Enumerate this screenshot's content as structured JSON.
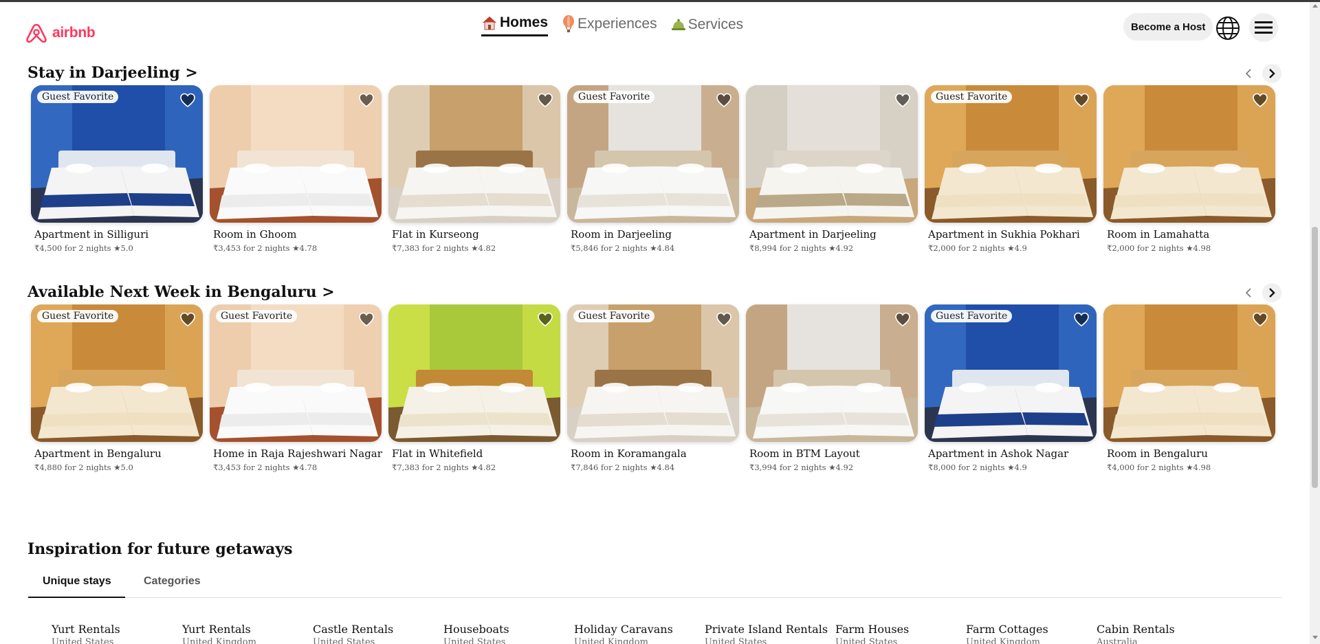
{
  "brand": {
    "name": "airbnb",
    "color": "#ff385c"
  },
  "nav": {
    "tabs": [
      {
        "label": "Homes",
        "icon": "house-icon",
        "active": true
      },
      {
        "label": "Experiences",
        "icon": "balloon-icon",
        "active": false
      },
      {
        "label": "Services",
        "icon": "service-bell-icon",
        "active": false
      }
    ]
  },
  "header": {
    "become_host_label": "Become a Host",
    "globe_icon": "globe-icon",
    "menu_icon": "hamburger-menu-icon"
  },
  "sections": [
    {
      "title": "Stay in Darjeeling >",
      "listings": [
        {
          "title": "Apartment in Silliguri",
          "meta": "₹4,500 for 2 nights ★5.0",
          "badge": "Guest Favorite",
          "scene": "blue"
        },
        {
          "title": "Room in Ghoom",
          "meta": "₹3,453 for 2 nights ★4.78",
          "badge": "",
          "scene": "peach"
        },
        {
          "title": "Flat in Kurseong",
          "meta": "₹7,383 for 2 nights ★4.82",
          "badge": "",
          "scene": "wood"
        },
        {
          "title": "Room in Darjeeling",
          "meta": "₹5,846 for 2 nights ★4.84",
          "badge": "Guest Favorite",
          "scene": "white"
        },
        {
          "title": "Apartment in Darjeeling",
          "meta": "₹8,994 for 2 nights ★4.92",
          "badge": "",
          "scene": "grey"
        },
        {
          "title": "Apartment in Sukhia Pokhari",
          "meta": "₹2,000 for 2 nights ★4.9",
          "badge": "Guest Favorite",
          "scene": "warm"
        },
        {
          "title": "Room in Lamahatta",
          "meta": "₹2,000 for 2 nights ★4.98",
          "badge": "",
          "scene": "warm"
        }
      ]
    },
    {
      "title": "Available Next Week in Bengaluru >",
      "listings": [
        {
          "title": "Apartment in Bengaluru",
          "meta": "₹4,880 for 2 nights ★5.0",
          "badge": "Guest Favorite",
          "scene": "warm"
        },
        {
          "title": "Home in Raja Rajeshwari Nagar",
          "meta": "₹3,453 for 2 nights ★4.78",
          "badge": "Guest Favorite",
          "scene": "peach"
        },
        {
          "title": "Flat in Whitefield",
          "meta": "₹7,383 for 2 nights ★4.82",
          "badge": "",
          "scene": "green"
        },
        {
          "title": "Room in Koramangala",
          "meta": "₹7,846 for 2 nights ★4.84",
          "badge": "Guest Favorite",
          "scene": "wood"
        },
        {
          "title": "Room in BTM Layout",
          "meta": "₹3,994 for 2 nights ★4.92",
          "badge": "",
          "scene": "white"
        },
        {
          "title": "Apartment in Ashok Nagar",
          "meta": "₹8,000 for 2 nights ★4.9",
          "badge": "Guest Favorite",
          "scene": "blue"
        },
        {
          "title": "Room in Bengaluru",
          "meta": "₹4,000 for 2 nights ★4.98",
          "badge": "",
          "scene": "warm"
        }
      ]
    }
  ],
  "inspiration": {
    "title": "Inspiration for future getaways",
    "tabs": [
      {
        "label": "Unique stays",
        "active": true
      },
      {
        "label": "Categories",
        "active": false
      }
    ],
    "destinations": [
      {
        "name": "Yurt Rentals",
        "sub": "United States"
      },
      {
        "name": "Yurt Rentals",
        "sub": "United Kingdom"
      },
      {
        "name": "Castle Rentals",
        "sub": "United States"
      },
      {
        "name": "Houseboats",
        "sub": "United States"
      },
      {
        "name": "Holiday Caravans",
        "sub": "United Kingdom"
      },
      {
        "name": "Private Island Rentals",
        "sub": "United States"
      },
      {
        "name": "Farm Houses",
        "sub": "United States"
      },
      {
        "name": "Farm Cottages",
        "sub": "United Kingdom"
      },
      {
        "name": "Cabin Rentals",
        "sub": "Australia"
      }
    ]
  }
}
